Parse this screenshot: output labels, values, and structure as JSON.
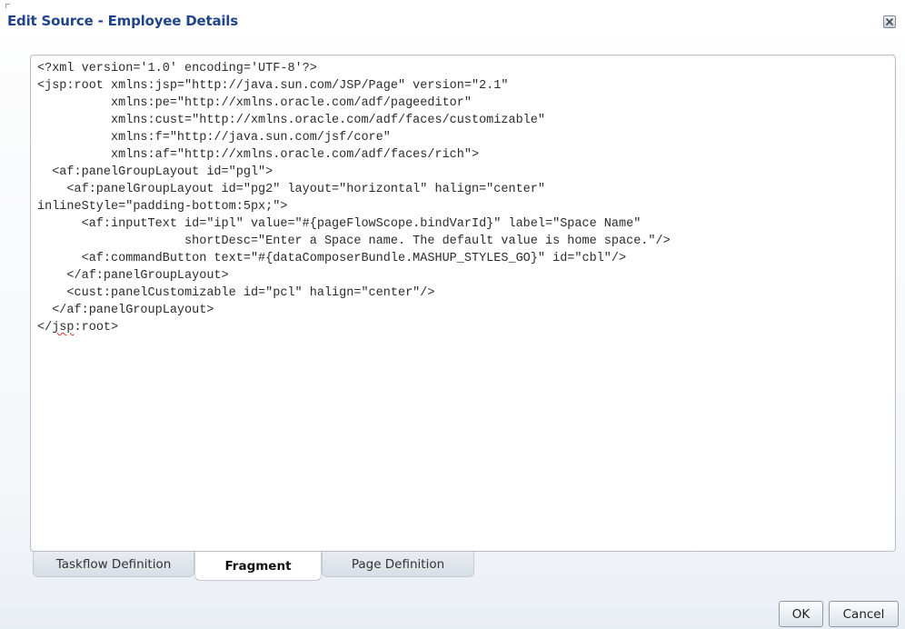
{
  "dialog": {
    "title": "Edit Source - Employee Details",
    "close_icon": "close-icon"
  },
  "editor": {
    "code_lines": [
      "<?xml version='1.0' encoding='UTF-8'?>",
      "<jsp:root xmlns:jsp=\"http://java.sun.com/JSP/Page\" version=\"2.1\"",
      "          xmlns:pe=\"http://xmlns.oracle.com/adf/pageeditor\"",
      "          xmlns:cust=\"http://xmlns.oracle.com/adf/faces/customizable\"",
      "          xmlns:f=\"http://java.sun.com/jsf/core\"",
      "          xmlns:af=\"http://xmlns.oracle.com/adf/faces/rich\">",
      "  <af:panelGroupLayout id=\"pgl\">",
      "    <af:panelGroupLayout id=\"pg2\" layout=\"horizontal\" halign=\"center\"",
      "inlineStyle=\"padding-bottom:5px;\">",
      "      <af:inputText id=\"ipl\" value=\"#{pageFlowScope.bindVarId}\" label=\"Space Name\"",
      "                    shortDesc=\"Enter a Space name. The default value is home space.\"/>",
      "      <af:commandButton text=\"#{dataComposerBundle.MASHUP_STYLES_GO}\" id=\"cbl\"/>",
      "    </af:panelGroupLayout>",
      "    <cust:panelCustomizable id=\"pcl\" halign=\"center\"/>",
      "  </af:panelGroupLayout>"
    ],
    "last_line_prefix": "</",
    "last_line_flagged": "jsp",
    "last_line_suffix": ":root>"
  },
  "tabs": [
    {
      "label": "Taskflow Definition",
      "active": false
    },
    {
      "label": "Fragment",
      "active": true
    },
    {
      "label": "Page Definition",
      "active": false
    }
  ],
  "buttons": {
    "ok_label": "OK",
    "cancel_label": "Cancel"
  },
  "colors": {
    "title": "#22458a",
    "spell_error_underline": "#e03030"
  }
}
